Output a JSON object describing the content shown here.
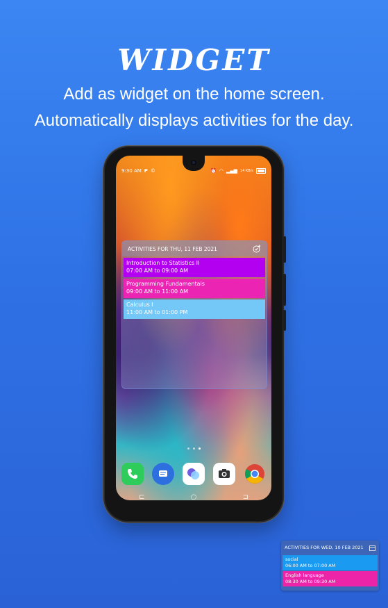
{
  "headline": "WIDGET",
  "subline1": "Add as widget on the home screen.",
  "subline2": "Automatically displays activities for the day.",
  "phone": {
    "status": {
      "time": "9:30 AM",
      "left_icons": [
        "P",
        "©"
      ],
      "right_text": "14 KB/s",
      "battery": "100"
    },
    "widget": {
      "title": "ACTIVITIES FOR THU, 11 FEB 2021",
      "add_icon": "calendar-add-icon",
      "activities": [
        {
          "name": "Introduction to Statistics II",
          "time": "07:00 AM to 09:00 AM",
          "color": "#b400f0"
        },
        {
          "name": "Programming Fundamentals",
          "time": "09:00 AM to 11:00 AM",
          "color": "#ec24b4"
        },
        {
          "name": "Calculus I",
          "time": "11:00 AM to 01:00 PM",
          "color": "#74c8f8"
        }
      ]
    },
    "dock": [
      "phone-app-icon",
      "messages-app-icon",
      "assistant-app-icon",
      "camera-app-icon",
      "chrome-app-icon"
    ]
  },
  "mini_widget": {
    "title": "ACTIVITIES FOR WED, 10 FEB 2021",
    "activities": [
      {
        "name": "social",
        "time": "06:00 AM to 07:00 AM",
        "color": "#1a9af0"
      },
      {
        "name": "English language",
        "time": "08:30 AM to 09:30 AM",
        "color": "#ec24a8"
      }
    ]
  },
  "colors": {
    "background": "#3b86f2",
    "activity_purple": "#b400f0",
    "activity_pink": "#ec24b4",
    "activity_blue": "#74c8f8"
  }
}
